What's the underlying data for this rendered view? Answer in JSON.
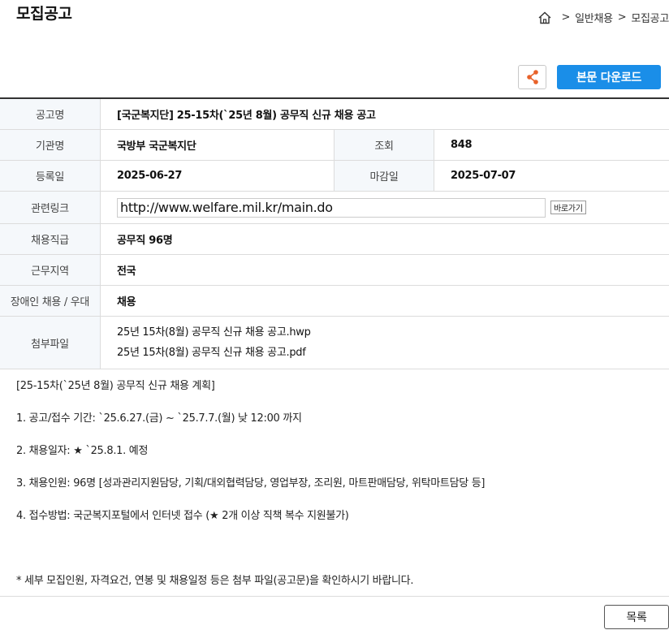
{
  "page": {
    "title": "모집공고"
  },
  "breadcrumb": {
    "sep1": ">",
    "item1": "일반채용",
    "sep2": ">",
    "item2": "모집공고"
  },
  "actions": {
    "download_label": "본문 다운로드"
  },
  "info": {
    "title_label": "공고명",
    "title_value": "[국군복지단] 25-15차(`25년 8월) 공무직 신규 채용 공고",
    "org_label": "기관명",
    "org_value": "국방부 국군복지단",
    "views_label": "조회",
    "views_value": "848",
    "reg_label": "등록일",
    "reg_value": "2025-06-27",
    "deadline_label": "마감일",
    "deadline_value": "2025-07-07",
    "link_label": "관련링크",
    "link_value": "http://www.welfare.mil.kr/main.do",
    "link_go_label": "바로가기",
    "grade_label": "채용직급",
    "grade_value": "공무직 96명",
    "region_label": "근무지역",
    "region_value": "전국",
    "disabled_label": "장애인 채용 / 우대",
    "disabled_value": "채용",
    "files_label": "첨부파일",
    "files": [
      "25년 15차(8월) 공무직 신규 채용 공고.hwp",
      "25년 15차(8월) 공무직 신규 채용 공고.pdf"
    ]
  },
  "body": {
    "heading": "[25-15차(`25년 8월) 공무직 신규 채용 계획]",
    "line1": "1. 공고/접수 기간: `25.6.27.(금) ~ `25.7.7.(월) 낮 12:00 까지",
    "line2": "2. 채용일자: ★ `25.8.1. 예정",
    "line3": "3. 채용인원: 96명 [성과관리지원담당, 기획/대외협력담당, 영업부장, 조리원, 마트판매담당, 위탁마트담당 등]",
    "line4": "4. 접수방법: 국군복지포털에서 인터넷 접수 (★ 2개 이상 직책 복수 지원불가)",
    "note": "* 세부 모집인원, 자격요건, 연봉 및 채용일정 등은 첨부 파일(공고문)을 확인하시기 바랍니다."
  },
  "footer": {
    "list_label": "목록"
  }
}
